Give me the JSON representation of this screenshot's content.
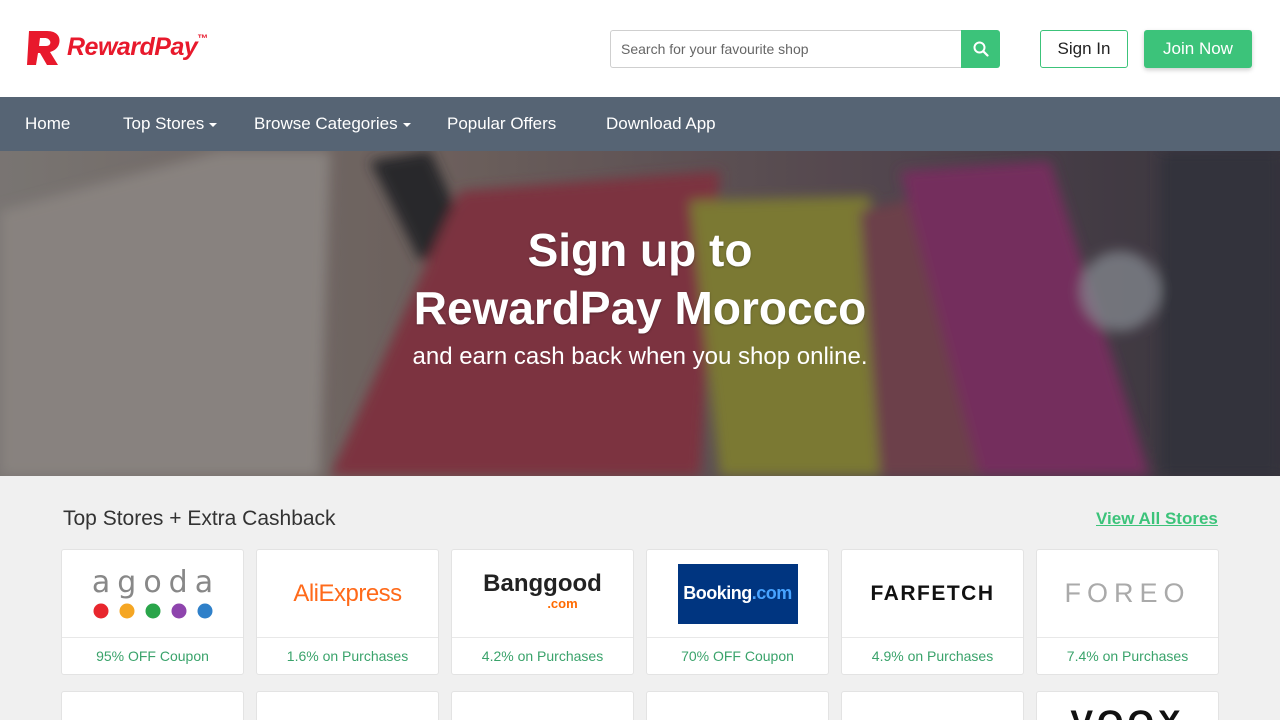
{
  "header": {
    "logo_text": "RewardPay",
    "logo_tm": "™",
    "search_placeholder": "Search for your favourite shop",
    "search_icon": "search-icon",
    "signin_label": "Sign In",
    "join_label": "Join Now"
  },
  "nav": {
    "items": [
      {
        "label": "Home"
      },
      {
        "label": "Top Stores"
      },
      {
        "label": "Browse Categories"
      },
      {
        "label": "Popular Offers"
      },
      {
        "label": "Download App"
      }
    ]
  },
  "hero": {
    "title_line1": "Sign up to",
    "title_line2": "RewardPay Morocco",
    "subtitle": "and earn cash back when you shop online."
  },
  "stores": {
    "title": "Top Stores + Extra Cashback",
    "view_all": "View All Stores",
    "items": [
      {
        "name": "agoda",
        "offer": "95% OFF Coupon"
      },
      {
        "name": "AliExpress",
        "offer": "1.6% on Purchases"
      },
      {
        "name": "Banggood",
        "sub": ".com",
        "offer": "4.2% on Purchases"
      },
      {
        "name": "Booking",
        "sub": ".com",
        "offer": "70% OFF Coupon"
      },
      {
        "name": "FARFETCH",
        "offer": "4.9% on Purchases"
      },
      {
        "name": "FOREO",
        "offer": "7.4% on Purchases"
      }
    ],
    "partial_last_logo": "VOOX"
  },
  "colors": {
    "brand_red": "#e8192c",
    "accent_green": "#3cc37a",
    "nav_bg": "#566474"
  }
}
